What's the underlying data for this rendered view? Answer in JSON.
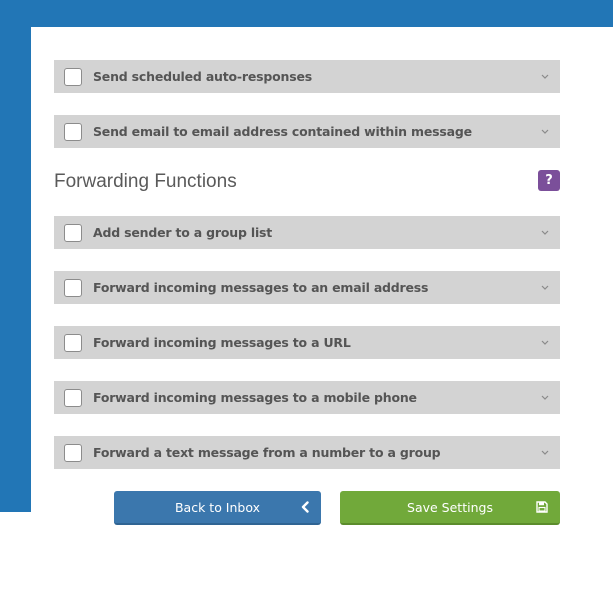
{
  "autoresponse_rows": [
    {
      "label": "Send scheduled auto-responses"
    },
    {
      "label": "Send email to email address contained within message"
    }
  ],
  "forwarding": {
    "title": "Forwarding Functions",
    "help_label": "?",
    "rows": [
      {
        "label": "Add sender to a group list"
      },
      {
        "label": "Forward incoming messages to an email address"
      },
      {
        "label": "Forward incoming messages to a URL"
      },
      {
        "label": "Forward incoming messages to a mobile phone"
      },
      {
        "label": "Forward a text message from a number to a group"
      }
    ]
  },
  "buttons": {
    "back_label": "Back to Inbox",
    "save_label": "Save Settings"
  },
  "icons": {
    "chevron": "chevron-down-icon",
    "back": "chevron-left-icon",
    "save": "floppy-disk-icon"
  },
  "colors": {
    "header_blue": "#2276b6",
    "row_bg": "#d3d3d3",
    "help_purple": "#7b4f9a",
    "back_blue": "#3b77ad",
    "save_green": "#71a93a"
  }
}
